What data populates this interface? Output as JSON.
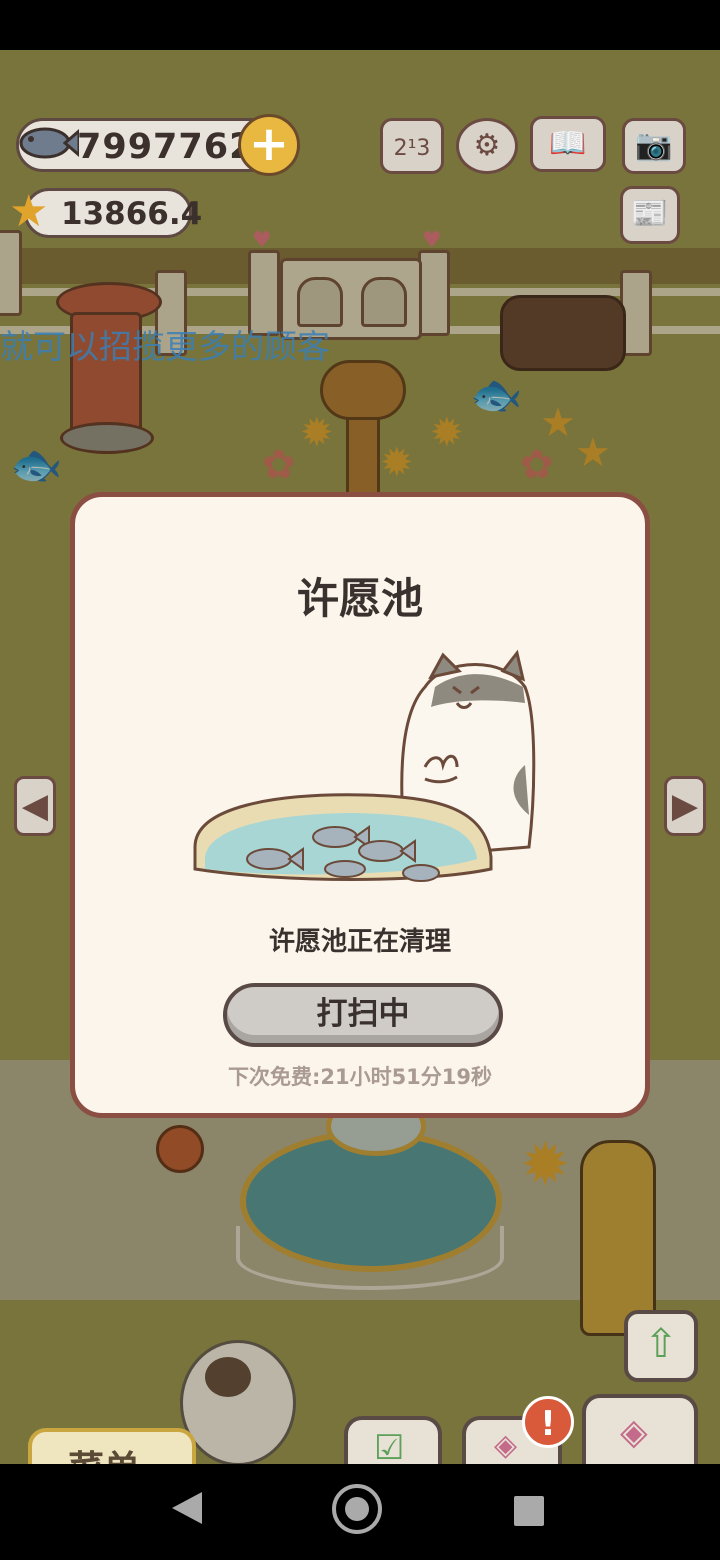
{
  "hud": {
    "fish_count": "7997762",
    "star_count": "13866.4"
  },
  "marquee_text": "就可以招揽更多的顾客",
  "dialog": {
    "title": "许愿池",
    "message": "许愿池正在清理",
    "button_label": "打扫中",
    "timer_text": "下次免费:21小时51分19秒"
  },
  "bottom": {
    "menu_label": "菜单"
  },
  "icons": {
    "ranking": "ranking-icon",
    "settings": "gear-icon",
    "book": "book-icon",
    "camera": "camera-icon",
    "news": "newspaper-icon"
  },
  "colors": {
    "dialog_border": "#8a4e42",
    "dialog_bg": "#fcf5ec",
    "coin_gold": "#e9b840",
    "alert_red": "#d9593b"
  }
}
